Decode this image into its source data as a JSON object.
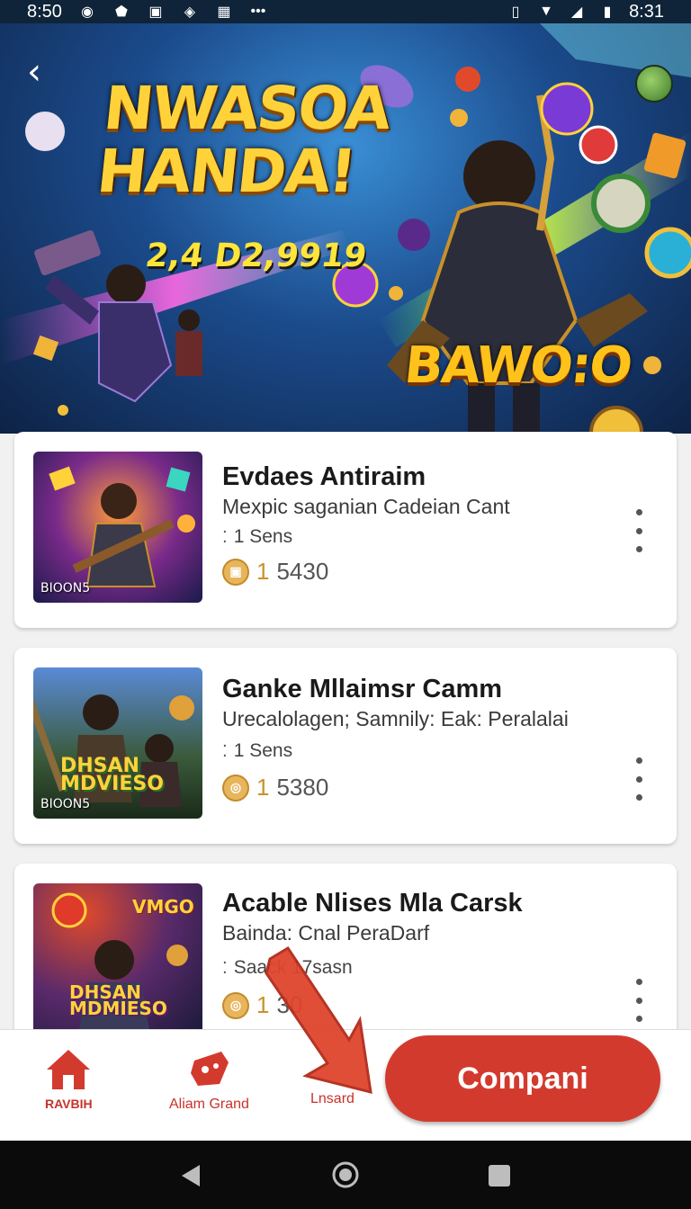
{
  "status_bar": {
    "time_left": "8:50",
    "time_right": "8:31",
    "icons_left": [
      "camera-icon",
      "shield-icon",
      "app-icon",
      "app-icon",
      "grid-icon",
      "more-icon"
    ],
    "icons_right": [
      "vibrate-icon",
      "wifi-icon",
      "signal-icon",
      "battery-icon"
    ]
  },
  "banner": {
    "back_glyph": "‹",
    "title": "NWASOA HANDA!",
    "subtitle": "2,4 D2,9919",
    "badge": "BAWO:O"
  },
  "cards": [
    {
      "title": "Evdaes Antiraim",
      "subtitle": "Mexpic saganian Cadeian Cant",
      "meta": "1 Sens",
      "price_prefix": "1",
      "price": "5430",
      "thumb_tag": "BIOON5"
    },
    {
      "title": "Ganke Mllaimsr Camm",
      "subtitle": "Urecalolagen; Samnily: Eak: Peralalai",
      "meta": "1 Sens",
      "price_prefix": "1",
      "price": "5380",
      "thumb_tag": "BIOON5",
      "thumb_caption": "DHSAN MDVIESO"
    },
    {
      "title": "Acable Nlises Mla Carsk",
      "subtitle": "Bainda: Cnal PeraDarf",
      "meta": "Saack 17sasn",
      "price_prefix": "1",
      "price": "30",
      "thumb_caption": "DHSAN MDMIESO",
      "thumb_top_text": "VMGO"
    }
  ],
  "bottom_nav": {
    "items": [
      {
        "label": "RAVBIH",
        "icon": "home-icon"
      },
      {
        "label": "Aliam Grand",
        "icon": "gamepad-icon"
      },
      {
        "label": "Lnsard",
        "icon": "none"
      }
    ],
    "cta_label": "Compani"
  },
  "colors": {
    "accent": "#d33a2e",
    "coin": "#e7b55b",
    "status_bar": "#0f2438"
  }
}
